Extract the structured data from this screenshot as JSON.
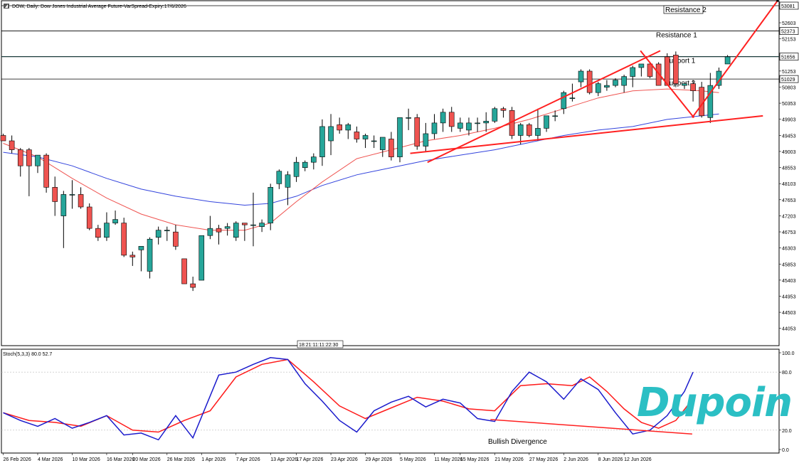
{
  "header": {
    "title": "DOW, Daily:  Dow Jones Industrial Average Future-VarSpread-Expiry:17/6/2026",
    "stoch_label": "Stoch(5,3,3) 80.0 52.7",
    "time_marker": "18:21:11:11:22:30"
  },
  "brand": {
    "logo_text": "Dupoin",
    "logo_color": "#2bbfc4"
  },
  "colors": {
    "bull": "#26a69a",
    "bear": "#ef5350",
    "ma_fast": "#ef5350",
    "ma_slow": "#3344dd",
    "trendline": "#ff2020",
    "stoch_main": "#1a1acc",
    "stoch_signal": "#ff1a1a"
  },
  "chart_data": [
    {
      "type": "candlestick",
      "symbol": "DOW",
      "timeframe": "Daily",
      "ylim": [
        43570,
        53220
      ],
      "y_ticks": [
        53081,
        52603,
        52153,
        51703,
        51253,
        50803,
        50353,
        49903,
        49453,
        49003,
        48553,
        48103,
        47653,
        47203,
        46753,
        46303,
        45853,
        45403,
        44953,
        44503,
        44053
      ],
      "price_labels": [
        {
          "value": 53081,
          "boxed": true
        },
        {
          "value": 52373,
          "boxed": true
        },
        {
          "value": 51656,
          "boxed": true
        },
        {
          "value": 51029,
          "boxed": true
        }
      ],
      "x_tick_labels": [
        "26 Feb 2026",
        "4 Mar 2026",
        "10 Mar 2026",
        "16 Mar 2026",
        "20 Mar 2026",
        "26 Mar 2026",
        "1 Apr 2026",
        "7 Apr 2026",
        "13 Apr 2026",
        "17 Apr 2026",
        "23 Apr 2026",
        "29 Apr 2026",
        "5 May 2026",
        "11 May 2026",
        "15 May 2026",
        "21 May 2026",
        "27 May 2026",
        "2 Jun 2026",
        "8 Jun 2026",
        "12 Jun 2026"
      ],
      "x_tick_index": [
        0,
        4,
        8,
        12,
        15,
        19,
        23,
        27,
        31,
        34,
        38,
        42,
        46,
        50,
        53,
        57,
        61,
        65,
        69,
        72
      ],
      "candles": [
        {
          "o": 49450,
          "h": 49500,
          "l": 49300,
          "c": 49300
        },
        {
          "o": 49300,
          "h": 49450,
          "l": 48950,
          "c": 49050
        },
        {
          "o": 49050,
          "h": 49100,
          "l": 48300,
          "c": 48600
        },
        {
          "o": 49050,
          "h": 49100,
          "l": 47750,
          "c": 48600
        },
        {
          "o": 48600,
          "h": 48900,
          "l": 48400,
          "c": 48900
        },
        {
          "o": 48900,
          "h": 48950,
          "l": 47850,
          "c": 48000
        },
        {
          "o": 48000,
          "h": 48300,
          "l": 47200,
          "c": 47600
        },
        {
          "o": 47200,
          "h": 47900,
          "l": 46300,
          "c": 47800
        },
        {
          "o": 47800,
          "h": 48200,
          "l": 47400,
          "c": 47800
        },
        {
          "o": 47800,
          "h": 48000,
          "l": 47400,
          "c": 47450
        },
        {
          "o": 47450,
          "h": 47550,
          "l": 46800,
          "c": 46850
        },
        {
          "o": 46850,
          "h": 46950,
          "l": 46500,
          "c": 46600
        },
        {
          "o": 46600,
          "h": 47300,
          "l": 46500,
          "c": 47000
        },
        {
          "o": 47000,
          "h": 47350,
          "l": 46950,
          "c": 47100
        },
        {
          "o": 47000,
          "h": 47150,
          "l": 46050,
          "c": 46100
        },
        {
          "o": 46100,
          "h": 46200,
          "l": 45800,
          "c": 46050
        },
        {
          "o": 46250,
          "h": 46300,
          "l": 45650,
          "c": 46350
        },
        {
          "o": 45650,
          "h": 46600,
          "l": 45450,
          "c": 46550
        },
        {
          "o": 46600,
          "h": 46900,
          "l": 46400,
          "c": 46800
        },
        {
          "o": 46800,
          "h": 46900,
          "l": 46500,
          "c": 46800
        },
        {
          "o": 46750,
          "h": 46950,
          "l": 46250,
          "c": 46350
        },
        {
          "o": 46000,
          "h": 46000,
          "l": 45300,
          "c": 45300
        },
        {
          "o": 45300,
          "h": 45500,
          "l": 45100,
          "c": 45200
        },
        {
          "o": 45400,
          "h": 46650,
          "l": 45400,
          "c": 46650
        },
        {
          "o": 46650,
          "h": 47200,
          "l": 46550,
          "c": 46850
        },
        {
          "o": 46850,
          "h": 46950,
          "l": 46400,
          "c": 46750
        },
        {
          "o": 46850,
          "h": 47000,
          "l": 46650,
          "c": 46900
        },
        {
          "o": 46600,
          "h": 47050,
          "l": 46500,
          "c": 47000
        },
        {
          "o": 47000,
          "h": 47000,
          "l": 46500,
          "c": 46950
        },
        {
          "o": 46950,
          "h": 47850,
          "l": 46350,
          "c": 46950
        },
        {
          "o": 46900,
          "h": 47100,
          "l": 46750,
          "c": 47000
        },
        {
          "o": 47000,
          "h": 48100,
          "l": 46800,
          "c": 48000
        },
        {
          "o": 48100,
          "h": 48500,
          "l": 47950,
          "c": 48450
        },
        {
          "o": 48000,
          "h": 48450,
          "l": 47500,
          "c": 48350
        },
        {
          "o": 48300,
          "h": 48850,
          "l": 48150,
          "c": 48700
        },
        {
          "o": 48550,
          "h": 48750,
          "l": 48450,
          "c": 48700
        },
        {
          "o": 48700,
          "h": 48950,
          "l": 48500,
          "c": 48850
        },
        {
          "o": 48850,
          "h": 49900,
          "l": 48600,
          "c": 49700
        },
        {
          "o": 49300,
          "h": 50050,
          "l": 48900,
          "c": 49700
        },
        {
          "o": 49750,
          "h": 49950,
          "l": 49500,
          "c": 49600
        },
        {
          "o": 49600,
          "h": 49800,
          "l": 49350,
          "c": 49750
        },
        {
          "o": 49550,
          "h": 49700,
          "l": 49250,
          "c": 49350
        },
        {
          "o": 49350,
          "h": 49500,
          "l": 49100,
          "c": 49450
        },
        {
          "o": 49300,
          "h": 49450,
          "l": 49100,
          "c": 49300
        },
        {
          "o": 49050,
          "h": 49350,
          "l": 48850,
          "c": 49400
        },
        {
          "o": 49350,
          "h": 49550,
          "l": 48750,
          "c": 48850
        },
        {
          "o": 48850,
          "h": 49950,
          "l": 48700,
          "c": 49950
        },
        {
          "o": 49950,
          "h": 50200,
          "l": 49600,
          "c": 49950
        },
        {
          "o": 49950,
          "h": 50050,
          "l": 49050,
          "c": 49150
        },
        {
          "o": 49150,
          "h": 49800,
          "l": 49000,
          "c": 49500
        },
        {
          "o": 49500,
          "h": 50050,
          "l": 49350,
          "c": 49800
        },
        {
          "o": 49800,
          "h": 50200,
          "l": 49550,
          "c": 50100
        },
        {
          "o": 50100,
          "h": 50250,
          "l": 49550,
          "c": 49700
        },
        {
          "o": 49650,
          "h": 49950,
          "l": 49550,
          "c": 49800
        },
        {
          "o": 49600,
          "h": 49950,
          "l": 49450,
          "c": 49800
        },
        {
          "o": 49800,
          "h": 49950,
          "l": 49550,
          "c": 49800
        },
        {
          "o": 49800,
          "h": 50100,
          "l": 49550,
          "c": 49850
        },
        {
          "o": 49850,
          "h": 50250,
          "l": 49800,
          "c": 50200
        },
        {
          "o": 50200,
          "h": 50250,
          "l": 49950,
          "c": 50150
        },
        {
          "o": 50150,
          "h": 50250,
          "l": 49350,
          "c": 49450
        },
        {
          "o": 49450,
          "h": 49800,
          "l": 49200,
          "c": 49750
        },
        {
          "o": 49750,
          "h": 49800,
          "l": 49400,
          "c": 49450
        },
        {
          "o": 49450,
          "h": 50200,
          "l": 49300,
          "c": 49650
        },
        {
          "o": 49650,
          "h": 50000,
          "l": 49550,
          "c": 50000
        },
        {
          "o": 50000,
          "h": 50150,
          "l": 49850,
          "c": 50000
        },
        {
          "o": 50200,
          "h": 50700,
          "l": 50050,
          "c": 50650
        },
        {
          "o": 50500,
          "h": 50900,
          "l": 50400,
          "c": 50500
        },
        {
          "o": 50950,
          "h": 51300,
          "l": 50800,
          "c": 51250
        },
        {
          "o": 51250,
          "h": 51300,
          "l": 50600,
          "c": 50650
        },
        {
          "o": 50650,
          "h": 50950,
          "l": 50550,
          "c": 50900
        },
        {
          "o": 50800,
          "h": 51000,
          "l": 50700,
          "c": 50850
        },
        {
          "o": 50850,
          "h": 51050,
          "l": 50800,
          "c": 51000
        },
        {
          "o": 50850,
          "h": 51150,
          "l": 50650,
          "c": 51100
        },
        {
          "o": 51100,
          "h": 51400,
          "l": 50800,
          "c": 51350
        },
        {
          "o": 51350,
          "h": 51450,
          "l": 51100,
          "c": 51450
        },
        {
          "o": 51450,
          "h": 51500,
          "l": 51050,
          "c": 51100
        },
        {
          "o": 51450,
          "h": 51500,
          "l": 50850,
          "c": 50850
        },
        {
          "o": 51650,
          "h": 51750,
          "l": 50850,
          "c": 50850
        },
        {
          "o": 51700,
          "h": 51800,
          "l": 50800,
          "c": 50900
        },
        {
          "o": 50850,
          "h": 50900,
          "l": 50750,
          "c": 50900
        },
        {
          "o": 50900,
          "h": 51000,
          "l": 50400,
          "c": 50700
        },
        {
          "o": 50800,
          "h": 50950,
          "l": 49950,
          "c": 50000
        },
        {
          "o": 49950,
          "h": 51200,
          "l": 49800,
          "c": 50850
        },
        {
          "o": 50850,
          "h": 51350,
          "l": 50750,
          "c": 51250
        },
        {
          "o": 51450,
          "h": 51700,
          "l": 51450,
          "c": 51650
        }
      ],
      "ma_fast": [
        [
          0,
          49230
        ],
        [
          4,
          48850
        ],
        [
          8,
          48250
        ],
        [
          12,
          47700
        ],
        [
          16,
          47250
        ],
        [
          20,
          46950
        ],
        [
          24,
          46800
        ],
        [
          28,
          46800
        ],
        [
          31,
          47000
        ],
        [
          34,
          47600
        ],
        [
          37,
          48150
        ],
        [
          41,
          48800
        ],
        [
          45,
          49050
        ],
        [
          49,
          49300
        ],
        [
          53,
          49450
        ],
        [
          57,
          49650
        ],
        [
          61,
          49900
        ],
        [
          65,
          50200
        ],
        [
          69,
          50500
        ],
        [
          73,
          50700
        ],
        [
          77,
          50750
        ],
        [
          81,
          50700
        ],
        [
          83,
          50650
        ]
      ],
      "ma_slow": [
        [
          0,
          48980
        ],
        [
          4,
          48850
        ],
        [
          8,
          48600
        ],
        [
          12,
          48250
        ],
        [
          16,
          47950
        ],
        [
          20,
          47750
        ],
        [
          24,
          47600
        ],
        [
          28,
          47500
        ],
        [
          31,
          47550
        ],
        [
          34,
          47750
        ],
        [
          37,
          48050
        ],
        [
          41,
          48350
        ],
        [
          45,
          48550
        ],
        [
          49,
          48750
        ],
        [
          53,
          48900
        ],
        [
          57,
          49050
        ],
        [
          61,
          49250
        ],
        [
          65,
          49450
        ],
        [
          69,
          49600
        ],
        [
          73,
          49700
        ],
        [
          77,
          49900
        ],
        [
          81,
          50000
        ],
        [
          83,
          50050
        ]
      ],
      "horizontal_levels": [
        {
          "name": "Resistance 2",
          "value": 53081,
          "boxed_label": true
        },
        {
          "name": "Resistance 1",
          "value": 52373,
          "boxed_label": false
        },
        {
          "name": "Support 1",
          "value": 51656,
          "boxed_label": false
        },
        {
          "name": "Support 2",
          "value": 51029,
          "boxed_label": false
        }
      ],
      "trendlines": [
        {
          "from": [
            49.2,
            48700
          ],
          "to": [
            76.2,
            51820
          ]
        },
        {
          "from": [
            73.9,
            51820
          ],
          "to": [
            80.1,
            49950
          ]
        },
        {
          "from": [
            79.9,
            49950
          ],
          "to": [
            89.8,
            53220
          ]
        },
        {
          "from": [
            47.2,
            48950
          ],
          "to": [
            88.1,
            50000
          ]
        }
      ]
    },
    {
      "type": "line",
      "title": "Stoch(5,3,3) 80.0 52.7",
      "ylim": [
        0,
        100
      ],
      "y_ticks": [
        100.0,
        80.0,
        20.0,
        0.0
      ],
      "levels": [
        80,
        20
      ],
      "series": [
        {
          "values": [
            [
              0,
              38
            ],
            [
              2,
              30
            ],
            [
              4,
              24
            ],
            [
              6,
              32
            ],
            [
              8,
              22
            ],
            [
              10,
              28
            ],
            [
              12,
              35
            ],
            [
              14,
              15
            ],
            [
              16,
              17
            ],
            [
              18,
              10
            ],
            [
              20,
              35
            ],
            [
              22,
              12
            ],
            [
              25,
              77
            ],
            [
              27,
              80
            ],
            [
              29,
              88
            ],
            [
              31,
              95
            ],
            [
              33,
              93
            ],
            [
              35,
              68
            ],
            [
              37,
              50
            ],
            [
              39,
              30
            ],
            [
              41,
              18
            ],
            [
              43,
              40
            ],
            [
              45,
              49
            ],
            [
              47,
              55
            ],
            [
              49,
              44
            ],
            [
              51,
              52
            ],
            [
              53,
              48
            ],
            [
              55,
              32
            ],
            [
              57,
              29
            ],
            [
              59,
              60
            ],
            [
              61,
              80
            ],
            [
              63,
              70
            ],
            [
              65,
              52
            ],
            [
              67,
              73
            ],
            [
              69,
              62
            ],
            [
              71,
              38
            ],
            [
              73,
              16
            ],
            [
              75,
              20
            ],
            [
              77,
              35
            ],
            [
              79,
              60
            ],
            [
              80,
              80
            ]
          ]
        },
        {
          "values": [
            [
              0,
              38
            ],
            [
              3,
              30
            ],
            [
              6,
              28
            ],
            [
              9,
              24
            ],
            [
              12,
              35
            ],
            [
              15,
              20
            ],
            [
              18,
              18
            ],
            [
              21,
              30
            ],
            [
              24,
              40
            ],
            [
              27,
              75
            ],
            [
              30,
              88
            ],
            [
              33,
              93
            ],
            [
              36,
              70
            ],
            [
              39,
              45
            ],
            [
              42,
              32
            ],
            [
              45,
              43
            ],
            [
              48,
              54
            ],
            [
              51,
              50
            ],
            [
              54,
              42
            ],
            [
              57,
              40
            ],
            [
              60,
              66
            ],
            [
              63,
              68
            ],
            [
              66,
              66
            ],
            [
              68,
              75
            ],
            [
              70,
              60
            ],
            [
              72,
              42
            ],
            [
              74,
              28
            ],
            [
              76,
              22
            ],
            [
              78,
              30
            ],
            [
              80,
              52.7
            ]
          ]
        }
      ],
      "annotations": [
        "Bullish Divergence"
      ],
      "divergence_line": {
        "from": [
          56.5,
          31
        ],
        "to": [
          79.9,
          16
        ]
      }
    }
  ]
}
